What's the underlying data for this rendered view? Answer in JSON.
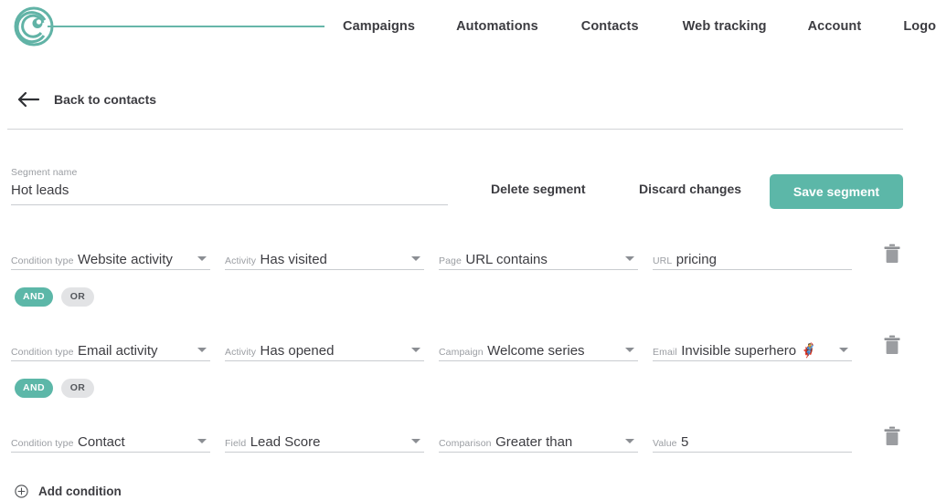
{
  "brand": {
    "logo_icon": "spiral-logo-icon",
    "accent_color": "#5cb7a8",
    "rule_color": "#66b6a9"
  },
  "nav": {
    "items": [
      {
        "label": "Campaigns"
      },
      {
        "label": "Automations"
      },
      {
        "label": "Contacts"
      },
      {
        "label": "Web tracking"
      },
      {
        "label": "Account"
      },
      {
        "label": "Logout"
      }
    ]
  },
  "back": {
    "icon": "arrow-left-icon",
    "label": "Back to contacts"
  },
  "segment": {
    "name_label": "Segment name",
    "name_value": "Hot leads",
    "delete_label": "Delete segment",
    "discard_label": "Discard changes",
    "save_label": "Save segment"
  },
  "conditions": [
    {
      "fields": [
        {
          "label": "Condition type",
          "value": "Website activity",
          "type": "select"
        },
        {
          "label": "Activity",
          "value": "Has visited",
          "type": "select"
        },
        {
          "label": "Page",
          "value": "URL contains",
          "type": "select"
        },
        {
          "label": "URL",
          "value": "pricing",
          "type": "text"
        }
      ],
      "delete_icon": "trash-icon"
    },
    {
      "fields": [
        {
          "label": "Condition type",
          "value": "Email activity",
          "type": "select"
        },
        {
          "label": "Activity",
          "value": "Has opened",
          "type": "select"
        },
        {
          "label": "Campaign",
          "value": "Welcome series",
          "type": "select"
        },
        {
          "label": "Email",
          "value": "Invisible superhero 🦸",
          "type": "select"
        }
      ],
      "delete_icon": "trash-icon"
    },
    {
      "fields": [
        {
          "label": "Condition type",
          "value": "Contact",
          "type": "select"
        },
        {
          "label": "Field",
          "value": "Lead Score",
          "type": "select"
        },
        {
          "label": "Comparison",
          "value": "Greater than",
          "type": "select"
        },
        {
          "label": "Value",
          "value": "5",
          "type": "text"
        }
      ],
      "delete_icon": "trash-icon"
    }
  ],
  "operators": [
    {
      "and_label": "AND",
      "or_label": "OR",
      "selected": "AND"
    },
    {
      "and_label": "AND",
      "or_label": "OR",
      "selected": "AND"
    }
  ],
  "add_condition": {
    "icon": "plus-circle-icon",
    "label": "Add condition"
  }
}
